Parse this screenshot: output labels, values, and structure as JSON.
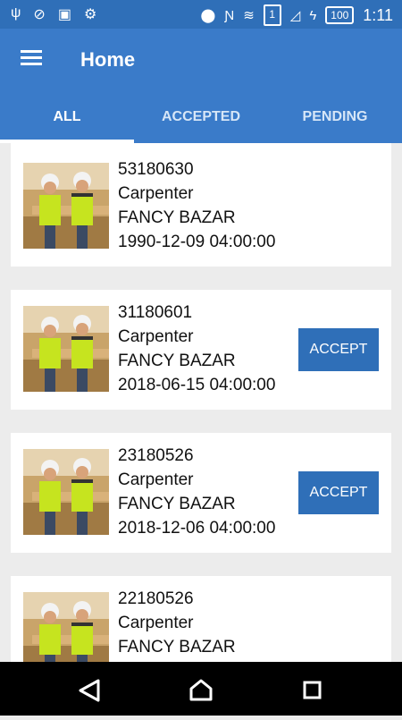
{
  "status_bar": {
    "icons_left": [
      "usb-icon",
      "no-tracking-icon",
      "fk-icon",
      "android-icon"
    ],
    "icons_right": [
      "location-icon",
      "nfc-icon",
      "wifi-icon",
      "sim-icon",
      "signal-icon",
      "charging-icon",
      "battery-icon"
    ],
    "sim_label": "1",
    "battery_level": "100",
    "time": "1:11"
  },
  "header": {
    "title": "Home",
    "menu_icon": "hamburger-icon"
  },
  "tabs": [
    {
      "label": "ALL",
      "active": true
    },
    {
      "label": "ACCEPTED",
      "active": false
    },
    {
      "label": "PENDING",
      "active": false
    }
  ],
  "jobs": [
    {
      "id": "53180630",
      "role": "Carpenter",
      "location": "FANCY BAZAR",
      "datetime": "1990-12-09 04:00:00",
      "accept_label": ""
    },
    {
      "id": "31180601",
      "role": "Carpenter",
      "location": "FANCY BAZAR",
      "datetime": "2018-06-15 04:00:00",
      "accept_label": "ACCEPT"
    },
    {
      "id": "23180526",
      "role": "Carpenter",
      "location": "FANCY BAZAR",
      "datetime": "2018-12-06 04:00:00",
      "accept_label": "ACCEPT"
    },
    {
      "id": "22180526",
      "role": "Carpenter",
      "location": "FANCY BAZAR",
      "datetime": "",
      "accept_label": ""
    }
  ],
  "nav_bar": {
    "icons": [
      "back-icon",
      "home-icon",
      "recents-icon"
    ]
  },
  "colors": {
    "status_bar": "#2f6fb8",
    "app_bar": "#3a7bc9",
    "accent": "#2f6fb8",
    "background": "#ececec"
  }
}
